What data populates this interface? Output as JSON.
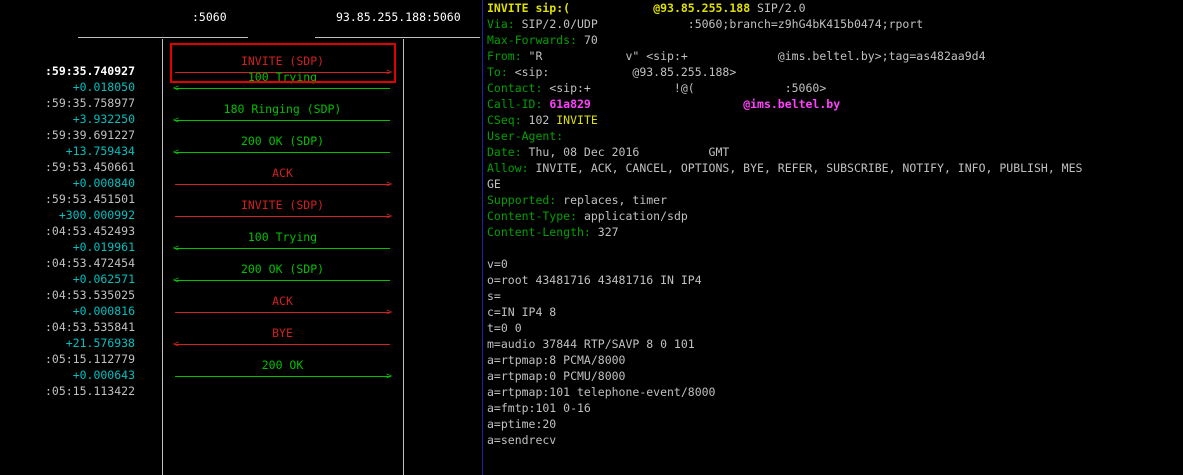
{
  "ladder": {
    "header_left": ":5060",
    "header_right": "93.85.255.188:5060",
    "rows": [
      {
        "time": ":59:35.740927",
        "kind": "sel",
        "msg": "INVITE (SDP)",
        "color": "r",
        "dir": "right"
      },
      {
        "time": "+0.018050",
        "kind": "delta",
        "msg": "100 Trying",
        "color": "g",
        "dir": "left"
      },
      {
        "time": ":59:35.758977",
        "kind": "abs-t"
      },
      {
        "time": "+3.932250",
        "kind": "delta",
        "msg": "180 Ringing (SDP)",
        "color": "g",
        "dir": "left"
      },
      {
        "time": ":59:39.691227",
        "kind": "abs-t"
      },
      {
        "time": "+13.759434",
        "kind": "delta",
        "msg": "200 OK (SDP)",
        "color": "g",
        "dir": "left"
      },
      {
        "time": ":59:53.450661",
        "kind": "abs-t"
      },
      {
        "time": "+0.000840",
        "kind": "delta",
        "msg": "ACK",
        "color": "r",
        "dir": "right"
      },
      {
        "time": ":59:53.451501",
        "kind": "abs-t"
      },
      {
        "time": "+300.000992",
        "kind": "delta",
        "msg": "INVITE (SDP)",
        "color": "r",
        "dir": "right"
      },
      {
        "time": ":04:53.452493",
        "kind": "abs-t"
      },
      {
        "time": "+0.019961",
        "kind": "delta",
        "msg": "100 Trying",
        "color": "g",
        "dir": "left"
      },
      {
        "time": ":04:53.472454",
        "kind": "abs-t"
      },
      {
        "time": "+0.062571",
        "kind": "delta",
        "msg": "200 OK (SDP)",
        "color": "g",
        "dir": "left"
      },
      {
        "time": ":04:53.535025",
        "kind": "abs-t"
      },
      {
        "time": "+0.000816",
        "kind": "delta",
        "msg": "ACK",
        "color": "r",
        "dir": "right"
      },
      {
        "time": ":04:53.535841",
        "kind": "abs-t"
      },
      {
        "time": "+21.576938",
        "kind": "delta",
        "msg": "BYE",
        "color": "r",
        "dir": "left"
      },
      {
        "time": ":05:15.112779",
        "kind": "abs-t"
      },
      {
        "time": "+0.000643",
        "kind": "delta",
        "msg": "200 OK",
        "color": "g",
        "dir": "right"
      },
      {
        "time": ":05:15.113422",
        "kind": "abs-t"
      }
    ]
  },
  "sip": {
    "lines": [
      [
        {
          "t": "INVITE sip:",
          "c": "y"
        },
        {
          "t": "(            ",
          "c": "y"
        },
        {
          "t": "@93.85.255.188",
          "c": "y"
        },
        {
          "t": " SIP/2.0",
          "c": "v"
        }
      ],
      [
        {
          "t": "Via: ",
          "c": "k"
        },
        {
          "t": "SIP/2.0/UDP             :5060;branch=z9hG4bK415b0474;rport",
          "c": "v"
        }
      ],
      [
        {
          "t": "Max-Forwards: ",
          "c": "k"
        },
        {
          "t": "70",
          "c": "v"
        }
      ],
      [
        {
          "t": "From: ",
          "c": "k"
        },
        {
          "t": "\"R            v\" <sip:+             @ims.beltel.by>;tag=as482aa9d4",
          "c": "v"
        }
      ],
      [
        {
          "t": "To: ",
          "c": "k"
        },
        {
          "t": "<sip:            @93.85.255.188>",
          "c": "v"
        }
      ],
      [
        {
          "t": "Contact: ",
          "c": "k"
        },
        {
          "t": "<sip:+            !@(             :5060>",
          "c": "v"
        }
      ],
      [
        {
          "t": "Call-ID: ",
          "c": "k"
        },
        {
          "t": "61a829",
          "c": "m"
        },
        {
          "t": "                      ",
          "c": "v"
        },
        {
          "t": "@ims.beltel.by",
          "c": "m"
        }
      ],
      [
        {
          "t": "CSeq: ",
          "c": "k"
        },
        {
          "t": "102 ",
          "c": "v"
        },
        {
          "t": "INVITE",
          "c": "yn"
        }
      ],
      [
        {
          "t": "User-Agent: ",
          "c": "k"
        }
      ],
      [
        {
          "t": "Date: ",
          "c": "k"
        },
        {
          "t": "Thu, 08 Dec 2016          GMT",
          "c": "v"
        }
      ],
      [
        {
          "t": "Allow: ",
          "c": "k"
        },
        {
          "t": "INVITE, ACK, CANCEL, OPTIONS, BYE, REFER, SUBSCRIBE, NOTIFY, INFO, PUBLISH, MES",
          "c": "v"
        }
      ],
      [
        {
          "t": "GE",
          "c": "v"
        }
      ],
      [
        {
          "t": "Supported: ",
          "c": "k"
        },
        {
          "t": "replaces, timer",
          "c": "v"
        }
      ],
      [
        {
          "t": "Content-Type: ",
          "c": "k"
        },
        {
          "t": "application/sdp",
          "c": "v"
        }
      ],
      [
        {
          "t": "Content-Length: ",
          "c": "k"
        },
        {
          "t": "327",
          "c": "v"
        }
      ],
      [
        {
          "t": "",
          "c": "v"
        }
      ],
      [
        {
          "t": "v=0",
          "c": "v"
        }
      ],
      [
        {
          "t": "o=root 43481716 43481716 IN IP4",
          "c": "v"
        }
      ],
      [
        {
          "t": "s=",
          "c": "v"
        }
      ],
      [
        {
          "t": "c=IN IP4 8",
          "c": "v"
        }
      ],
      [
        {
          "t": "t=0 0",
          "c": "v"
        }
      ],
      [
        {
          "t": "m=audio 37844 RTP/SAVP 8 0 101",
          "c": "v"
        }
      ],
      [
        {
          "t": "a=rtpmap:8 PCMA/8000",
          "c": "v"
        }
      ],
      [
        {
          "t": "a=rtpmap:0 PCMU/8000",
          "c": "v"
        }
      ],
      [
        {
          "t": "a=rtpmap:101 telephone-event/8000",
          "c": "v"
        }
      ],
      [
        {
          "t": "a=fmtp:101 0-16",
          "c": "v"
        }
      ],
      [
        {
          "t": "a=ptime:20",
          "c": "v"
        }
      ],
      [
        {
          "t": "a=sendrecv",
          "c": "v"
        }
      ]
    ]
  }
}
